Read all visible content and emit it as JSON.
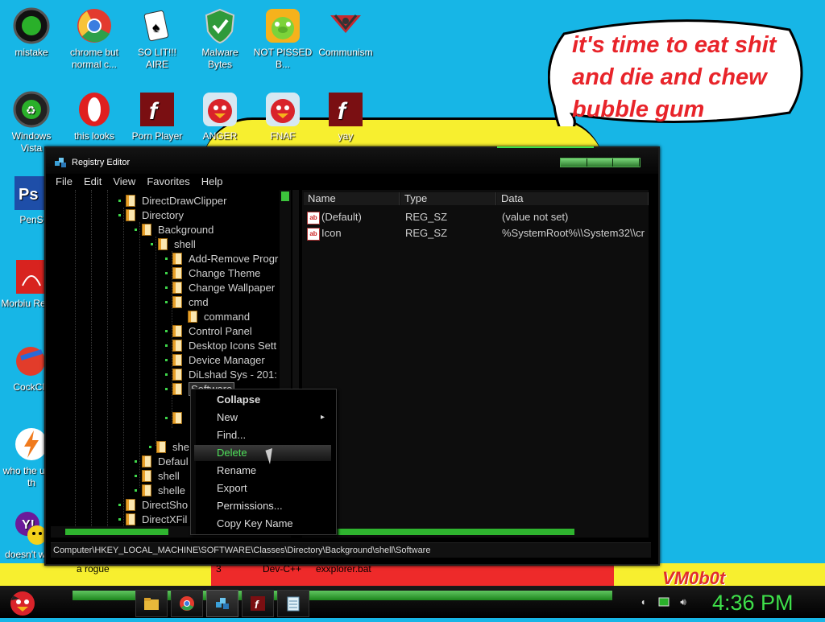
{
  "desktop": {
    "icons": [
      {
        "label": "mistake",
        "icon": "xbox-icon"
      },
      {
        "label": "chrome but normal c...",
        "icon": "chrome-icon"
      },
      {
        "label": "SO LIT!!! AIRE",
        "icon": "solitaire-icon"
      },
      {
        "label": "Malware Bytes",
        "icon": "shield-icon"
      },
      {
        "label": "NOT PISSED B...",
        "icon": "angry-birds-pig-icon"
      },
      {
        "label": "Communism",
        "icon": "communism-icon"
      },
      {
        "label": "Windows Vista",
        "icon": "recycle-bin-icon"
      },
      {
        "label": "this looks",
        "icon": "opera-icon"
      },
      {
        "label": "Porn Player",
        "icon": "flash-icon"
      },
      {
        "label": "ANGER",
        "icon": "angry-bird-icon"
      },
      {
        "label": "FNAF",
        "icon": "angry-bird-icon"
      },
      {
        "label": "yay",
        "icon": "flash-icon"
      },
      {
        "label": "PenS",
        "icon": "photoshop-icon"
      },
      {
        "label": "Morbiu Reade",
        "icon": "pdf-icon"
      },
      {
        "label": "CockCle",
        "icon": "ccleaner-icon"
      },
      {
        "label": "who the uses th",
        "icon": "bolt-icon"
      },
      {
        "label": "doesn't w lol",
        "icon": "yahoo-icon"
      }
    ],
    "speech_bubble": "it's time to eat shit and die and chew bubble gum",
    "behind_window_texts": [
      "a rogue",
      "3",
      "Dev-C++",
      "exxplorer.bat"
    ],
    "watermark": "VM0b0t"
  },
  "window": {
    "title": "Registry Editor",
    "menu": [
      "File",
      "Edit",
      "View",
      "Favorites",
      "Help"
    ],
    "tree": [
      {
        "label": "DirectDrawClipper",
        "level": 0
      },
      {
        "label": "Directory",
        "level": 0
      },
      {
        "label": "Background",
        "level": 1
      },
      {
        "label": "shell",
        "level": 2
      },
      {
        "label": "Add-Remove Progr",
        "level": 3
      },
      {
        "label": "Change Theme",
        "level": 3
      },
      {
        "label": "Change Wallpaper",
        "level": 3
      },
      {
        "label": "cmd",
        "level": 3
      },
      {
        "label": "command",
        "level": 4
      },
      {
        "label": "Control Panel",
        "level": 3
      },
      {
        "label": "Desktop Icons Sett",
        "level": 3
      },
      {
        "label": "Device Manager",
        "level": 3
      },
      {
        "label": "DiLshad Sys - 201:",
        "level": 3
      },
      {
        "label": "Software",
        "level": 3
      },
      {
        "label": "",
        "level": 3
      },
      {
        "label": "",
        "level": 3
      },
      {
        "label": "she",
        "level": 2
      },
      {
        "label": "Defaul",
        "level": 1
      },
      {
        "label": "shell",
        "level": 1
      },
      {
        "label": "shelle",
        "level": 1
      },
      {
        "label": "DirectSho",
        "level": 0
      },
      {
        "label": "DirectXFil",
        "level": 0
      }
    ],
    "columns": [
      "Name",
      "Type",
      "Data"
    ],
    "values": [
      {
        "name": "(Default)",
        "type": "REG_SZ",
        "data": "(value not set)"
      },
      {
        "name": "Icon",
        "type": "REG_SZ",
        "data": "%SystemRoot%\\\\System32\\\\cr"
      }
    ],
    "status_path": "Computer\\HKEY_LOCAL_MACHINE\\SOFTWARE\\Classes\\Directory\\Background\\shell\\Software"
  },
  "context_menu": {
    "items": [
      "Collapse",
      "New",
      "Find...",
      "Delete",
      "Rename",
      "Export",
      "Permissions...",
      "Copy Key Name"
    ],
    "selected": "Delete"
  },
  "taskbar": {
    "start": "angry-bird-start-icon",
    "buttons": [
      "folder-icon",
      "chrome-icon",
      "registry-icon",
      "flash-icon",
      "notepad-icon"
    ],
    "active": "registry-icon",
    "tray": [
      "network-icon",
      "battery-icon",
      "volume-icon"
    ],
    "clock": "4:36 PM"
  },
  "colors": {
    "desktop": "#17b6e6",
    "accent_green": "#3ee04a",
    "bubble_text": "#e8242a",
    "window_bg": "#000000"
  }
}
